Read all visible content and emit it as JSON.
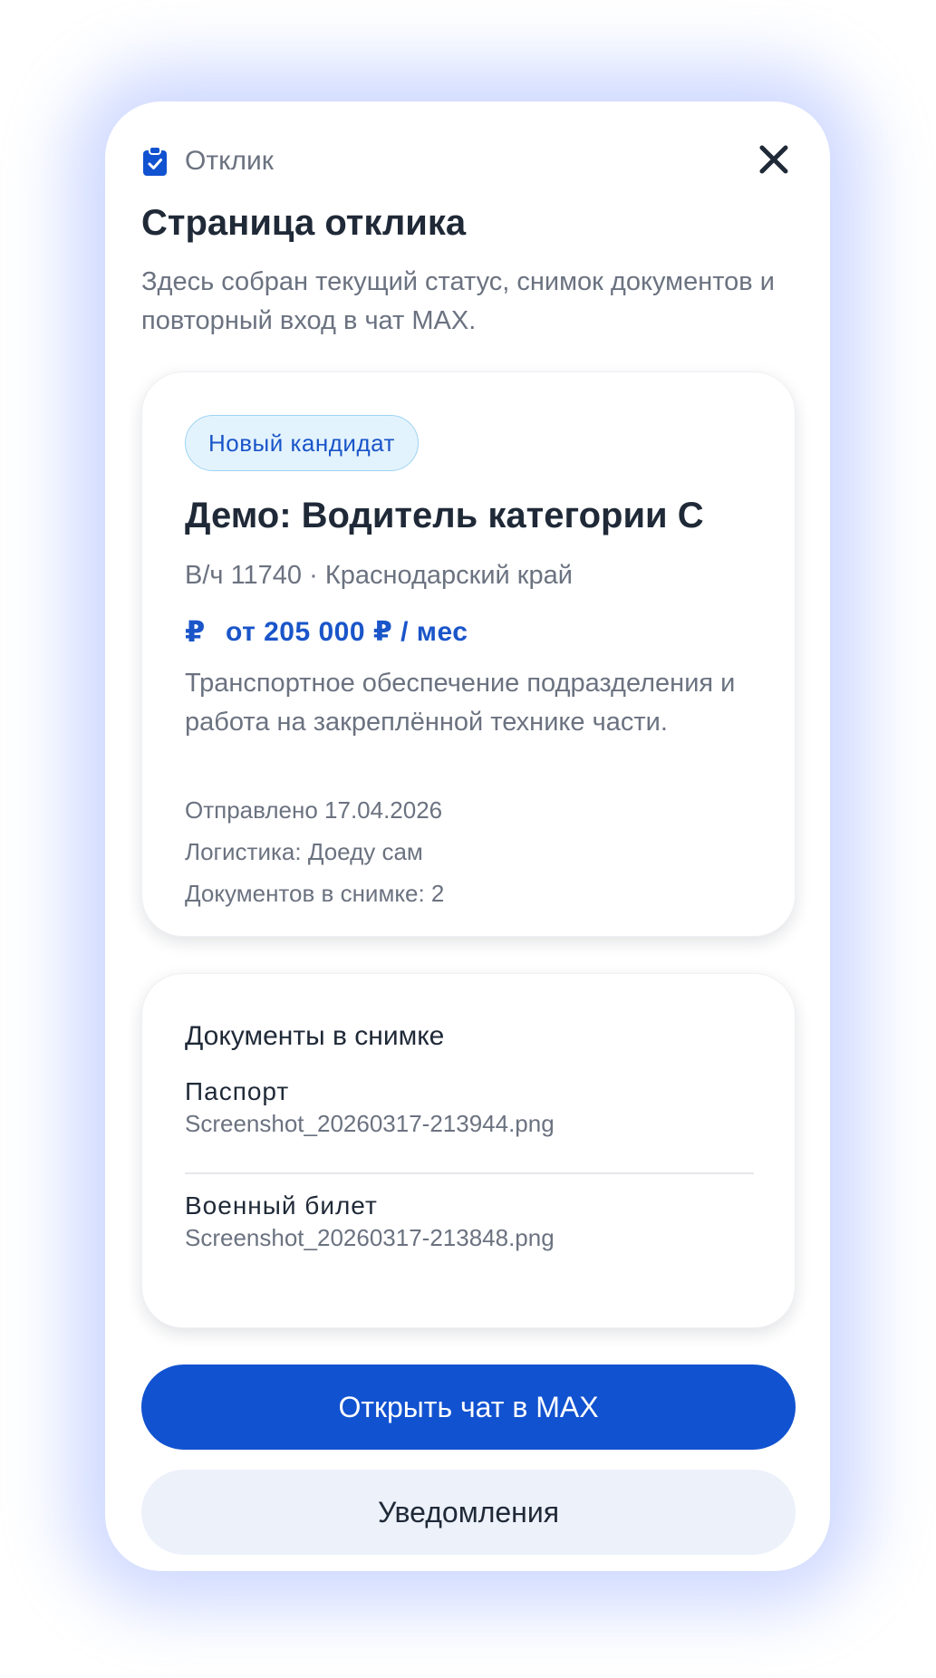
{
  "header": {
    "breadcrumb_icon": "clipboard-check-icon",
    "breadcrumb_label": "Отклик",
    "close_icon": "close-icon",
    "title": "Страница отклика",
    "description": "Здесь собран текущий статус, снимок документов и повторный вход в чат MAX."
  },
  "application": {
    "status_badge": "Новый кандидат",
    "job_title": "Демо: Водитель категории C",
    "location": "В/ч 11740 · Краснодарский край",
    "salary_icon": "₽",
    "salary": "от 205 000 ₽ / мес",
    "description": "Транспортное обеспечение подразделения и работа на закреплённой технике части.",
    "sent": "Отправлено 17.04.2026",
    "logistics": "Логистика: Доеду сам",
    "documents_count": "Документов в снимке: 2"
  },
  "documents": {
    "title": "Документы в снимке",
    "items": [
      {
        "name": "Паспорт",
        "file": "Screenshot_20260317-213944.png"
      },
      {
        "name": "Военный билет",
        "file": "Screenshot_20260317-213848.png"
      }
    ]
  },
  "actions": {
    "open_chat": "Открыть чат в MAX",
    "notifications": "Уведомления"
  },
  "colors": {
    "accent": "#1152d0",
    "badge_bg": "#e3f3fd",
    "text_primary": "#1f2937",
    "text_secondary": "#6b7280"
  }
}
